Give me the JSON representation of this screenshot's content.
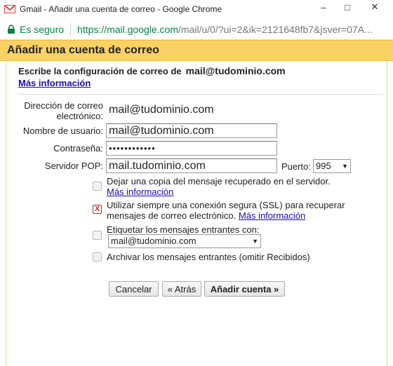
{
  "window": {
    "title": "Gmail - Añadir una cuenta de correo - Google Chrome",
    "controls": {
      "minimize": "–",
      "maximize": "□",
      "close": "✕"
    }
  },
  "address_bar": {
    "secure_label": "Es seguro",
    "url_host": "https://mail.google.com",
    "url_rest": "/mail/u/0/?ui=2&ik=2121648fb7&jsver=07A..."
  },
  "dialog": {
    "title": "Añadir una cuenta de correo",
    "intro_text": "Escribe la configuración de correo de",
    "intro_email": "mail@tudominio.com",
    "more_info_link": "Más información"
  },
  "form": {
    "email_label": "Dirección de correo electrónico:",
    "email_value": "mail@tudominio.com",
    "username_label": "Nombre de usuario:",
    "username_value": "mail@tudominio.com",
    "password_label": "Contraseña:",
    "password_value": "••••••••••••",
    "pop_server_label": "Servidor POP:",
    "pop_server_value": "mail.tudominio.com",
    "port_label": "Puerto:",
    "port_value": "995"
  },
  "options": [
    {
      "text": "Dejar una copia del mensaje recuperado en el servidor.",
      "link": "Más información",
      "checked": false
    },
    {
      "text": "Utilizar siempre una conexión segura (SSL) para recuperar mensajes de correo electrónico.",
      "link": "Más información",
      "checked": true
    },
    {
      "text": "Etiquetar los mensajes entrantes con:",
      "select_value": "mail@tudominio.com",
      "checked": false
    },
    {
      "text": "Archivar los mensajes entrantes (omitir Recibidos)",
      "checked": false
    }
  ],
  "buttons": {
    "cancel": "Cancelar",
    "back": "« Atrás",
    "add_account": "Añadir cuenta »"
  },
  "colors": {
    "header_bg": "#fad163",
    "secure_green": "#0b8043",
    "link_blue": "#1a0dab",
    "checkbox_red": "#cc3333"
  },
  "icons": {
    "app": "gmail-logo-icon",
    "secure": "lock-icon",
    "dropdown": "triangle-down-icon"
  }
}
